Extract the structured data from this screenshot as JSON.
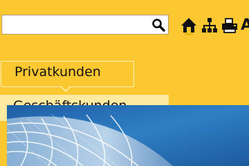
{
  "search": {
    "value": "",
    "placeholder": ""
  },
  "toolbar": {
    "icons": [
      "home-icon",
      "sitemap-icon",
      "printer-icon"
    ],
    "font_size_label": "A"
  },
  "segments": {
    "private_label": "Privatkunden",
    "business_label": "Geschäftskunden",
    "active": "business"
  },
  "colors": {
    "page_background": "#fcc832",
    "active_tab_background": "#fde99f",
    "hero_sky": "#2a73b8"
  }
}
